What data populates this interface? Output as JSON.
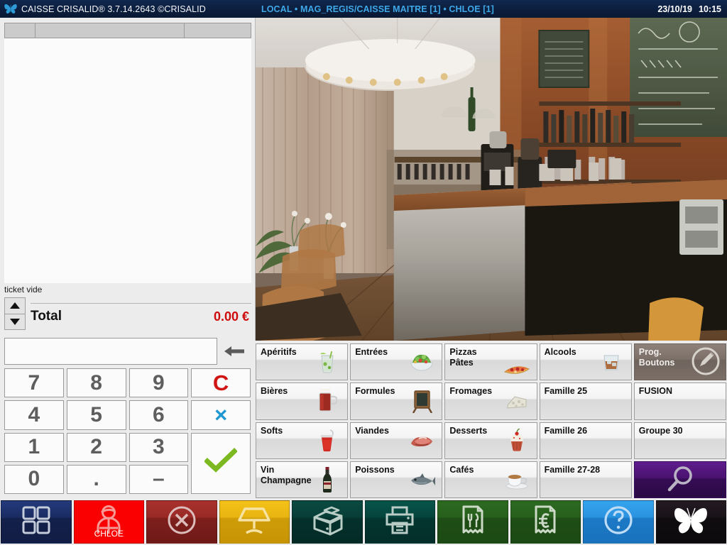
{
  "titlebar": {
    "logo_icon": "butterfly-icon",
    "app_title": "CAISSE CRISALID® 3.7.14.2643 ©CRISALID",
    "session": "LOCAL • MAG_REGIS/CAISSE MAITRE [1] • CHLOE [1]",
    "date": "23/10/19",
    "time": "10:15",
    "bg_color": "#0c1e3e",
    "accent_color": "#3ea8e8"
  },
  "ticket": {
    "columns": [
      "",
      "",
      ""
    ],
    "rows": [],
    "empty_label": "ticket vide",
    "total_label": "Total",
    "total_value": "0.00 €",
    "total_color": "#cf0a0a",
    "scroll_up_icon": "arrow-up-icon",
    "scroll_down_icon": "arrow-down-icon"
  },
  "keypad": {
    "input_value": "",
    "input_placeholder": "",
    "backspace_icon": "arrow-left-icon",
    "keys": [
      {
        "label": "7",
        "name": "key-7"
      },
      {
        "label": "8",
        "name": "key-8"
      },
      {
        "label": "9",
        "name": "key-9"
      },
      {
        "label": "C",
        "name": "key-clear"
      },
      {
        "label": "4",
        "name": "key-4"
      },
      {
        "label": "5",
        "name": "key-5"
      },
      {
        "label": "6",
        "name": "key-6"
      },
      {
        "label": "×",
        "name": "key-multiply"
      },
      {
        "label": "1",
        "name": "key-1"
      },
      {
        "label": "2",
        "name": "key-2"
      },
      {
        "label": "3",
        "name": "key-3"
      },
      {
        "label": "✓",
        "name": "key-validate"
      },
      {
        "label": "0",
        "name": "key-0"
      },
      {
        "label": ".",
        "name": "key-decimal"
      },
      {
        "label": "–",
        "name": "key-minus"
      }
    ],
    "clear_color": "#d11414",
    "multiply_color": "#1f97d0",
    "validate_color": "#7cb81f"
  },
  "photo": {
    "alt": "cafe-bar-interior-photo"
  },
  "categories": [
    {
      "label": "Apéritifs",
      "icon": "mojito-glass-icon",
      "name": "category-aperitifs"
    },
    {
      "label": "Entrées",
      "icon": "salad-bowl-icon",
      "name": "category-entrees"
    },
    {
      "label": "Pizzas\nPâtes",
      "icon": "pizza-slice-icon",
      "name": "category-pizzas-pates"
    },
    {
      "label": "Alcools",
      "icon": "whisky-glass-icon",
      "name": "category-alcools"
    },
    {
      "label": "Prog.\nBoutons",
      "icon": "pencil-edit-icon",
      "name": "category-prog-boutons",
      "style": "prog"
    },
    {
      "label": "Bières",
      "icon": "beer-mug-icon",
      "name": "category-bieres"
    },
    {
      "label": "Formules",
      "icon": "chalkboard-icon",
      "name": "category-formules"
    },
    {
      "label": "Fromages",
      "icon": "cheese-icon",
      "name": "category-fromages"
    },
    {
      "label": "Famille 25",
      "icon": "",
      "name": "category-famille-25"
    },
    {
      "label": "FUSION",
      "icon": "",
      "name": "category-fusion"
    },
    {
      "label": "Softs",
      "icon": "soda-cup-icon",
      "name": "category-softs"
    },
    {
      "label": "Viandes",
      "icon": "meat-icon",
      "name": "category-viandes"
    },
    {
      "label": "Desserts",
      "icon": "cupcake-icon",
      "name": "category-desserts"
    },
    {
      "label": "Famille 26",
      "icon": "",
      "name": "category-famille-26"
    },
    {
      "label": "Groupe 30",
      "icon": "",
      "name": "category-groupe-30"
    },
    {
      "label": "Vin\nChampagne",
      "icon": "wine-bottle-icon",
      "name": "category-vin-champagne"
    },
    {
      "label": "Poissons",
      "icon": "fish-icon",
      "name": "category-poissons"
    },
    {
      "label": "Cafés",
      "icon": "coffee-cup-icon",
      "name": "category-cafes"
    },
    {
      "label": "Famille 27-28",
      "icon": "",
      "name": "category-famille-27-28"
    },
    {
      "label": "",
      "icon": "magnifier-icon",
      "name": "category-search",
      "style": "search"
    }
  ],
  "toolbar": [
    {
      "name": "toolbar-apps",
      "icon": "grid-squares-icon",
      "label": "",
      "style": "t-apps"
    },
    {
      "name": "toolbar-user",
      "icon": "user-icon",
      "label": "CHLOE",
      "style": "t-user"
    },
    {
      "name": "toolbar-cancel",
      "icon": "cancel-circle-icon",
      "label": "",
      "style": "t-cancel"
    },
    {
      "name": "toolbar-tables",
      "icon": "table-lamp-icon",
      "label": "",
      "style": "t-table"
    },
    {
      "name": "toolbar-drawer",
      "icon": "cash-drawer-icon",
      "label": "",
      "style": "t-drawer"
    },
    {
      "name": "toolbar-print",
      "icon": "printer-icon",
      "label": "",
      "style": "t-print"
    },
    {
      "name": "toolbar-order",
      "icon": "receipt-cutlery-icon",
      "label": "",
      "style": "t-order"
    },
    {
      "name": "toolbar-bill",
      "icon": "receipt-euro-icon",
      "label": "",
      "style": "t-bill"
    },
    {
      "name": "toolbar-help",
      "icon": "question-circle-icon",
      "label": "",
      "style": "t-help"
    },
    {
      "name": "toolbar-logo",
      "icon": "butterfly-icon",
      "label": "",
      "style": "t-logo"
    }
  ]
}
